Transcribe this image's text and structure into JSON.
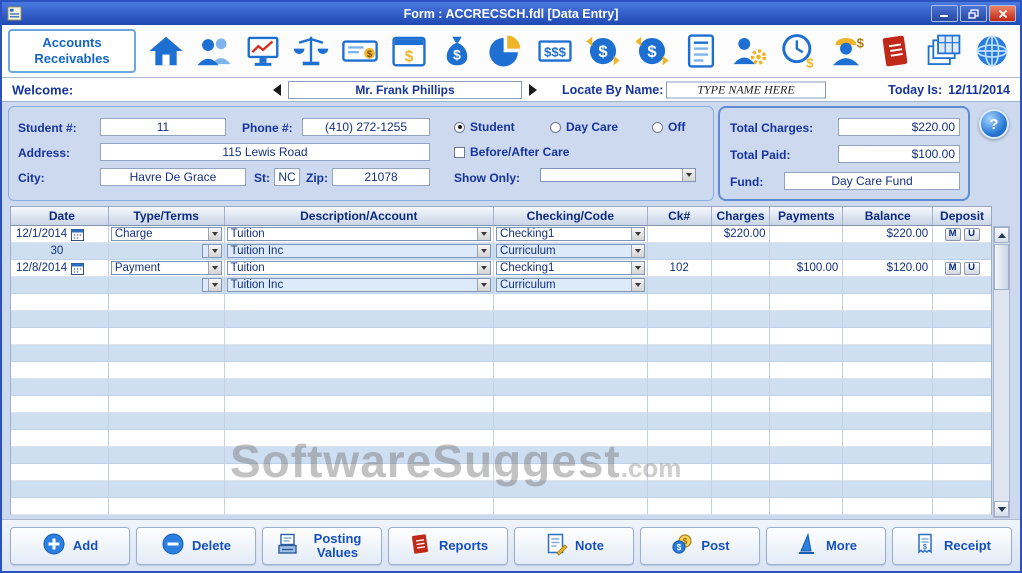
{
  "window": {
    "title": "Form : ACCRECSCH.fdl [Data Entry]"
  },
  "toolbar": {
    "module_button": "Accounts Receivables",
    "icon_names": [
      "home",
      "clients",
      "performance",
      "balances",
      "checks",
      "billing",
      "funds",
      "budget",
      "cash",
      "money-out",
      "money-in",
      "ledger",
      "administration",
      "time-billing",
      "payroll",
      "reports",
      "worksheets",
      "internet"
    ]
  },
  "welcome": {
    "label": "Welcome:",
    "name": "Mr. Frank Phillips",
    "locate_label": "Locate By Name:",
    "locate_value": "TYPE NAME HERE",
    "today_label": "Today Is:",
    "today_value": "12/11/2014"
  },
  "form": {
    "student_label": "Student #:",
    "student_value": "11",
    "phone_label": "Phone #:",
    "phone_value": "(410) 272-1255",
    "address_label": "Address:",
    "address_value": "115 Lewis Road",
    "city_label": "City:",
    "city_value": "Havre De Grace",
    "st_label": "St:",
    "st_value": "NC",
    "zip_label": "Zip:",
    "zip_value": "21078",
    "radio_student": "Student",
    "radio_daycare": "Day Care",
    "radio_off": "Off",
    "before_after_label": "Before/After Care",
    "show_only_label": "Show Only:",
    "show_only_value": ""
  },
  "totals": {
    "charges_label": "Total Charges:",
    "charges_value": "$220.00",
    "paid_label": "Total Paid:",
    "paid_value": "$100.00",
    "fund_label": "Fund:",
    "fund_value": "Day Care Fund"
  },
  "help_glyph": "?",
  "grid": {
    "headers": [
      "Date",
      "Type/Terms",
      "Description/Account",
      "Checking/Code",
      "Ck#",
      "Charges",
      "Payments",
      "Balance",
      "Deposit"
    ],
    "deposit": {
      "matched": "M",
      "unmatched": "U"
    },
    "rows": [
      {
        "date": "12/1/2014",
        "type": "Charge",
        "description": "Tuition",
        "checking": "Checking1",
        "ck": "",
        "charges": "$220.00",
        "payments": "",
        "balance": "$220.00"
      },
      {
        "terms": "30",
        "description": "Tuition Inc",
        "checking": "Curriculum"
      },
      {
        "date": "12/8/2014",
        "type": "Payment",
        "description": "Tuition",
        "checking": "Checking1",
        "ck": "102",
        "charges": "",
        "payments": "$100.00",
        "balance": "$120.00"
      },
      {
        "terms": "",
        "description": "Tuition Inc",
        "checking": "Curriculum"
      }
    ]
  },
  "watermark": {
    "text": "SoftwareSuggest",
    "suffix": ".com"
  },
  "buttons": [
    {
      "label": "Add"
    },
    {
      "label": "Delete"
    },
    {
      "label": "Posting Values"
    },
    {
      "label": "Reports"
    },
    {
      "label": "Note"
    },
    {
      "label": "Post"
    },
    {
      "label": "More"
    },
    {
      "label": "Receipt"
    }
  ]
}
